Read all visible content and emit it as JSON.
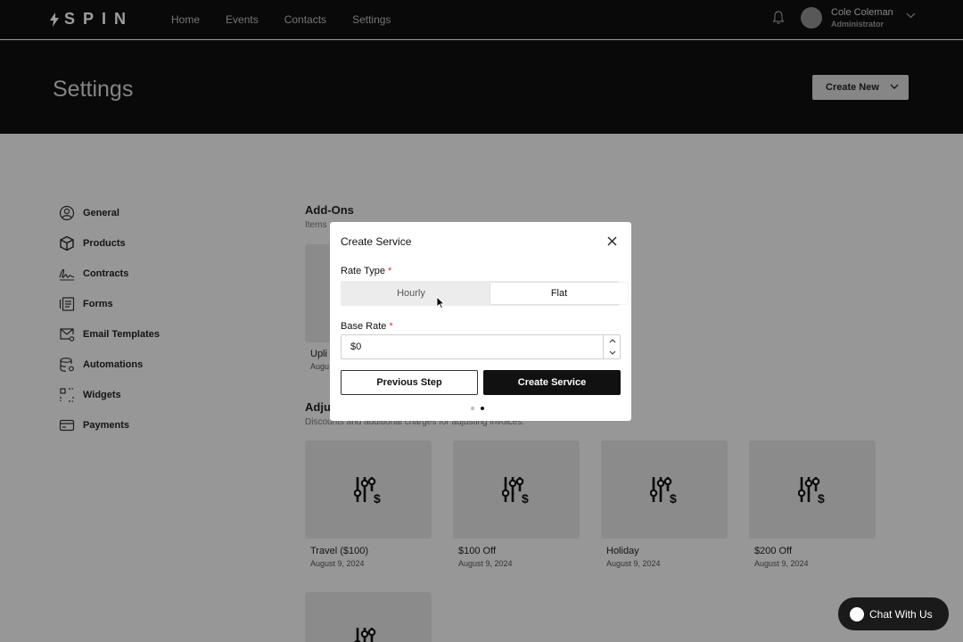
{
  "nav": {
    "logo": "SPIN",
    "links": [
      "Home",
      "Events",
      "Contacts",
      "Settings"
    ],
    "user_name": "Cole Coleman",
    "user_role": "Administrator"
  },
  "header": {
    "title": "Settings",
    "create_new": "Create New"
  },
  "sidebar": {
    "items": [
      {
        "label": "General",
        "icon": "user-circle-icon"
      },
      {
        "label": "Products",
        "icon": "box-icon"
      },
      {
        "label": "Contracts",
        "icon": "signature-icon"
      },
      {
        "label": "Forms",
        "icon": "form-icon"
      },
      {
        "label": "Email Templates",
        "icon": "mail-gear-icon"
      },
      {
        "label": "Automations",
        "icon": "database-gear-icon"
      },
      {
        "label": "Widgets",
        "icon": "widget-icon"
      },
      {
        "label": "Payments",
        "icon": "card-icon"
      }
    ]
  },
  "addons": {
    "title": "Add-Ons",
    "subtitle": "Items",
    "partial_card_title": "Upli",
    "partial_card_date": "Augu"
  },
  "adjustments": {
    "title_partial": "Adju",
    "subtitle": "Discounts and additional charges for adjusting invoices.",
    "cards": [
      {
        "title": "Travel ($100)",
        "date": "August 9, 2024"
      },
      {
        "title": "$100 Off",
        "date": "August 9, 2024"
      },
      {
        "title": "Holiday",
        "date": "August 9, 2024"
      },
      {
        "title": "$200 Off",
        "date": "August 9, 2024"
      }
    ]
  },
  "modal": {
    "title": "Create Service",
    "rate_type_label": "Rate Type",
    "required_mark": "*",
    "rate_options": [
      "Hourly",
      "Flat"
    ],
    "selected_rate": "Flat",
    "base_rate_label": "Base Rate",
    "base_rate_value": "$0",
    "prev_button": "Previous Step",
    "create_button": "Create Service",
    "step_current": 2,
    "step_total": 2
  },
  "chat": {
    "label": "Chat With Us"
  }
}
